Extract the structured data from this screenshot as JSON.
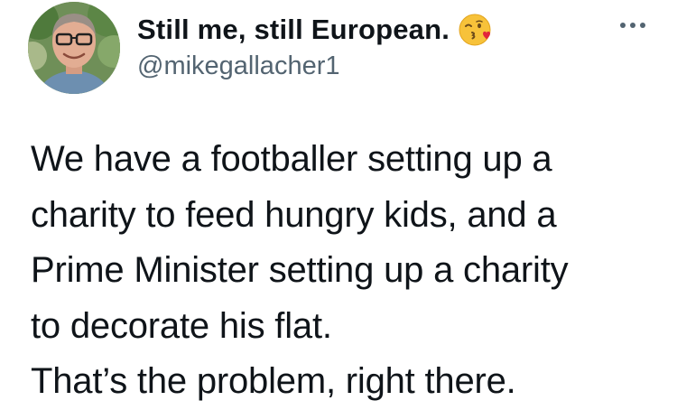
{
  "author": {
    "display_name": "Still me, still European.",
    "emoji_name": "face-blowing-a-kiss-emoji",
    "handle": "@mikegallacher1"
  },
  "more_button": {
    "icon": "more-horizontal-icon"
  },
  "tweet": {
    "lines": [
      "We have a footballer setting up a",
      "charity to feed hungry kids, and a",
      "Prime Minister setting up a charity",
      "to decorate his flat.",
      "That’s the problem, right there."
    ]
  },
  "colors": {
    "text": "#0f1419",
    "secondary_text": "#536471",
    "background": "#ffffff"
  }
}
